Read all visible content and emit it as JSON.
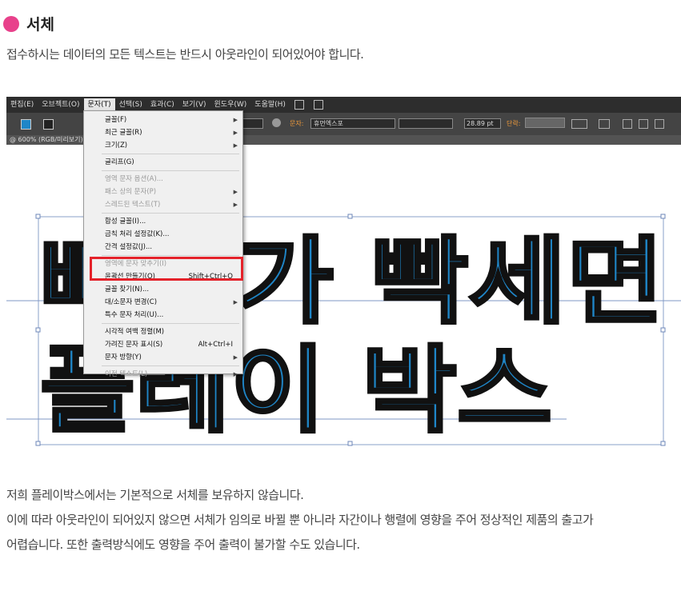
{
  "heading": {
    "title": "서체",
    "colors": {
      "bullet": "#e8418b"
    }
  },
  "intro": "접수하시는 데이터의 모든 텍스트는 반드시 아웃라인이 되어있어야 합니다.",
  "screenshot": {
    "menubar": [
      "편집(E)",
      "오브젝트(O)",
      "문자(T)",
      "선택(S)",
      "효과(C)",
      "보기(V)",
      "윈도우(W)",
      "도움말(H)"
    ],
    "active_menu": "문자(T)",
    "control_bar": {
      "char_label": "문자:",
      "font_family": "휴먼엑스포",
      "font_size": "28.89 pt",
      "paragraph_label": "단락:"
    },
    "status": "@ 600% (RGB/미리보기)",
    "canvas_text": [
      "빠르가 빡세면",
      "플레이 박스"
    ],
    "colors": {
      "glyph_fill": "#1f86c8",
      "glyph_stroke": "#111111",
      "highlight": "#e4222a"
    },
    "menu_items": [
      {
        "label": "글꼴(F)",
        "submenu": true
      },
      {
        "label": "최근 글꼴(R)",
        "submenu": true
      },
      {
        "label": "크기(Z)",
        "submenu": true
      },
      {
        "separator": true
      },
      {
        "label": "글리프(G)"
      },
      {
        "separator": true
      },
      {
        "label": "영역 문자 옵션(A)...",
        "disabled": true
      },
      {
        "label": "패스 상의 문자(P)",
        "disabled": true,
        "submenu": true
      },
      {
        "label": "스레드된 텍스트(T)",
        "disabled": true,
        "submenu": true
      },
      {
        "separator": true
      },
      {
        "label": "합성 글꼴(I)..."
      },
      {
        "label": "금칙 처리 설정값(K)..."
      },
      {
        "label": "간격 설정값(J)..."
      },
      {
        "separator": true
      },
      {
        "label": "영역에 문자 맞추기(I)",
        "disabled": true
      },
      {
        "label": "윤곽선 만들기(O)",
        "shortcut": "Shift+Ctrl+O",
        "highlighted": true
      },
      {
        "label": "글꼴 찾기(N)..."
      },
      {
        "label": "대/소문자 변경(C)",
        "submenu": true
      },
      {
        "label": "특수 문자 처리(U)..."
      },
      {
        "separator": true
      },
      {
        "label": "시각적 여백 정렬(M)"
      },
      {
        "label": "가려진 문자 표시(S)",
        "shortcut": "Alt+Ctrl+I"
      },
      {
        "label": "문자 방향(Y)",
        "submenu": true
      },
      {
        "separator": true
      },
      {
        "label": "이전 텍스트(L)",
        "disabled": true,
        "submenu": true
      }
    ]
  },
  "body": [
    "저희 플레이박스에서는 기본적으로 서체를 보유하지 않습니다.",
    "이에 따라 아웃라인이 되어있지 않으면 서체가 임의로 바뀔 뿐 아니라 자간이나 행렬에 영향을 주어 정상적인 제품의 출고가",
    "어렵습니다. 또한 출력방식에도 영향을 주어 출력이 불가할 수도 있습니다."
  ]
}
